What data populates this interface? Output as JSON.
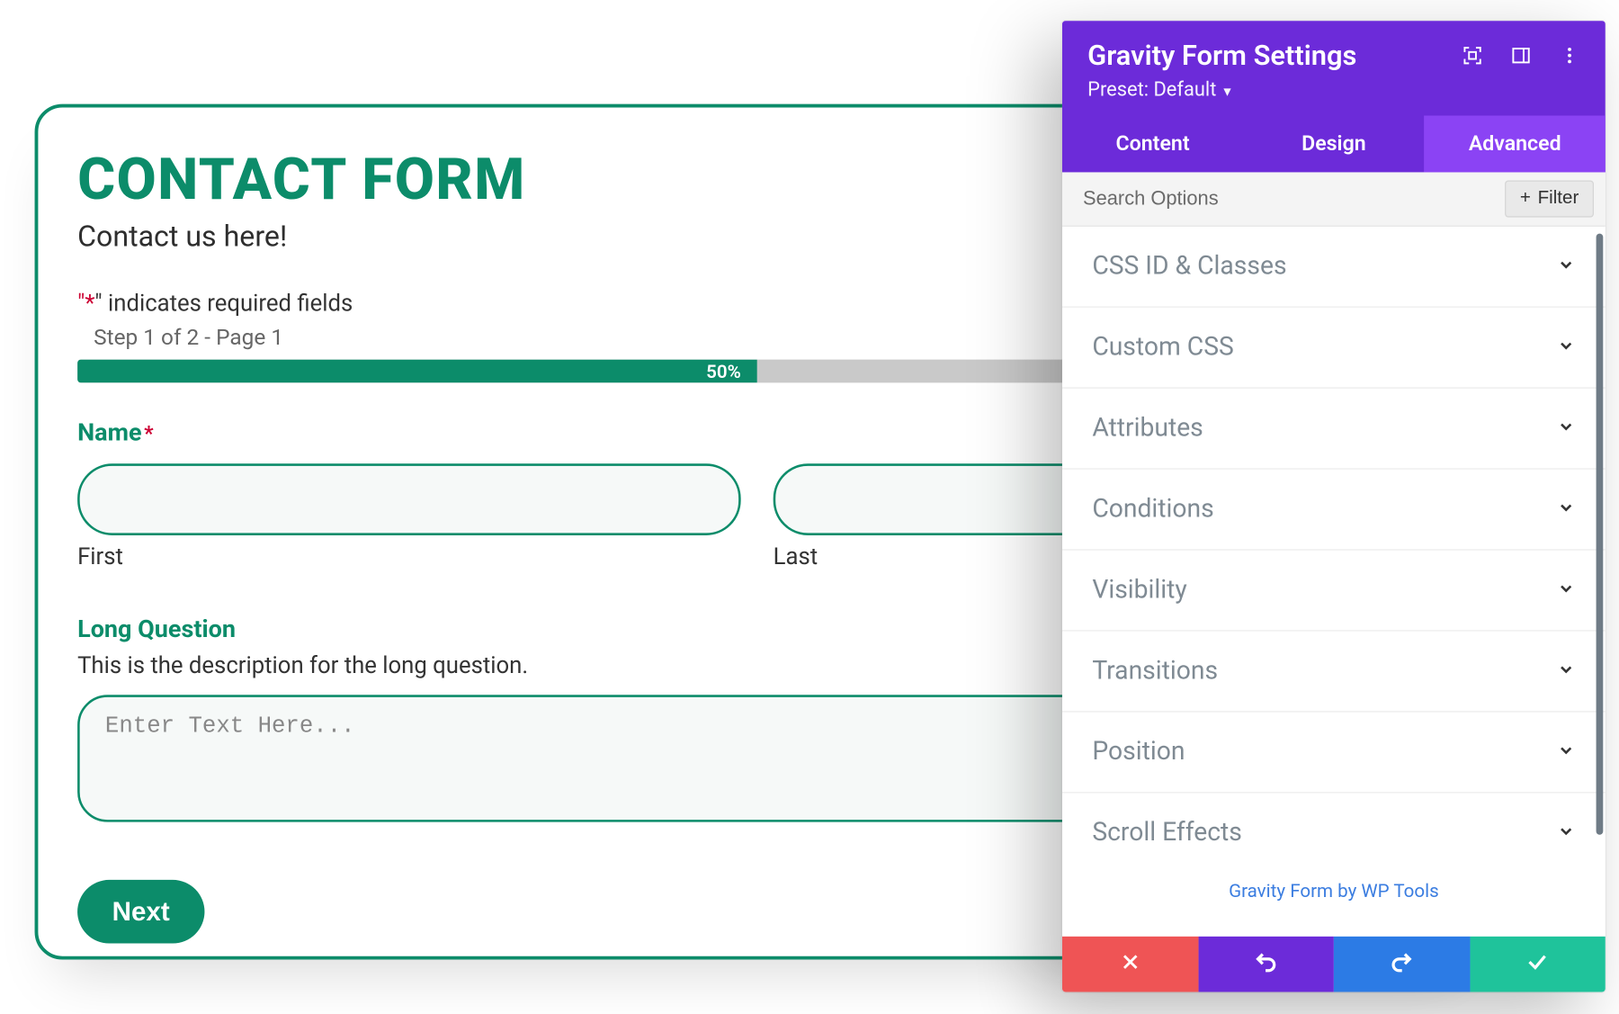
{
  "form": {
    "title": "CONTACT FORM",
    "subtitle": "Contact us here!",
    "required_note_prefix": "\"",
    "required_note_mid": "*",
    "required_note_suffix": "\" indicates required fields",
    "step_note": "Step 1 of 2 - Page 1",
    "progress_percent": "50%",
    "name_label": "Name",
    "required_mark": "*",
    "first_label": "First",
    "last_label": "Last",
    "long_q_label": "Long Question",
    "long_q_desc": "This is the description for the long question.",
    "textarea_placeholder": "Enter Text Here...",
    "next_label": "Next"
  },
  "panel": {
    "title": "Gravity Form Settings",
    "preset_label": "Preset: Default",
    "tabs": [
      {
        "label": "Content",
        "active": false
      },
      {
        "label": "Design",
        "active": false
      },
      {
        "label": "Advanced",
        "active": true
      }
    ],
    "search_placeholder": "Search Options",
    "filter_label": "Filter",
    "sections": [
      {
        "label": "CSS ID & Classes"
      },
      {
        "label": "Custom CSS"
      },
      {
        "label": "Attributes"
      },
      {
        "label": "Conditions"
      },
      {
        "label": "Visibility"
      },
      {
        "label": "Transitions"
      },
      {
        "label": "Position"
      },
      {
        "label": "Scroll Effects"
      }
    ],
    "footer_link": "Gravity Form by WP Tools"
  }
}
